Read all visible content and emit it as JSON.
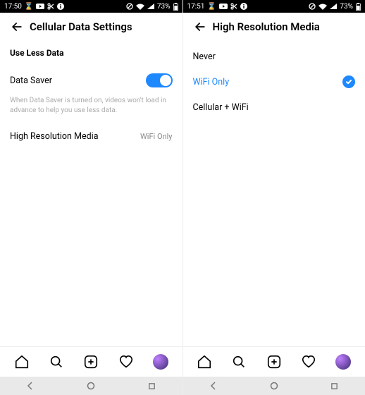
{
  "left": {
    "status": {
      "time": "17:50",
      "battery": "73%"
    },
    "header": {
      "title": "Cellular Data Settings"
    },
    "section": {
      "title": "Use Less Data"
    },
    "dataSaver": {
      "label": "Data Saver",
      "helpText": "When Data Saver is turned on, videos won't load in advance to help you use less data."
    },
    "highRes": {
      "label": "High Resolution Media",
      "value": "WiFi Only"
    }
  },
  "right": {
    "status": {
      "time": "17:51",
      "battery": "73%"
    },
    "header": {
      "title": "High Resolution Media"
    },
    "options": {
      "never": "Never",
      "wifiOnly": "WiFi Only",
      "cellWifi": "Cellular + WiFi"
    }
  },
  "icons": {
    "hourglass": "⌛",
    "dot": "●"
  }
}
